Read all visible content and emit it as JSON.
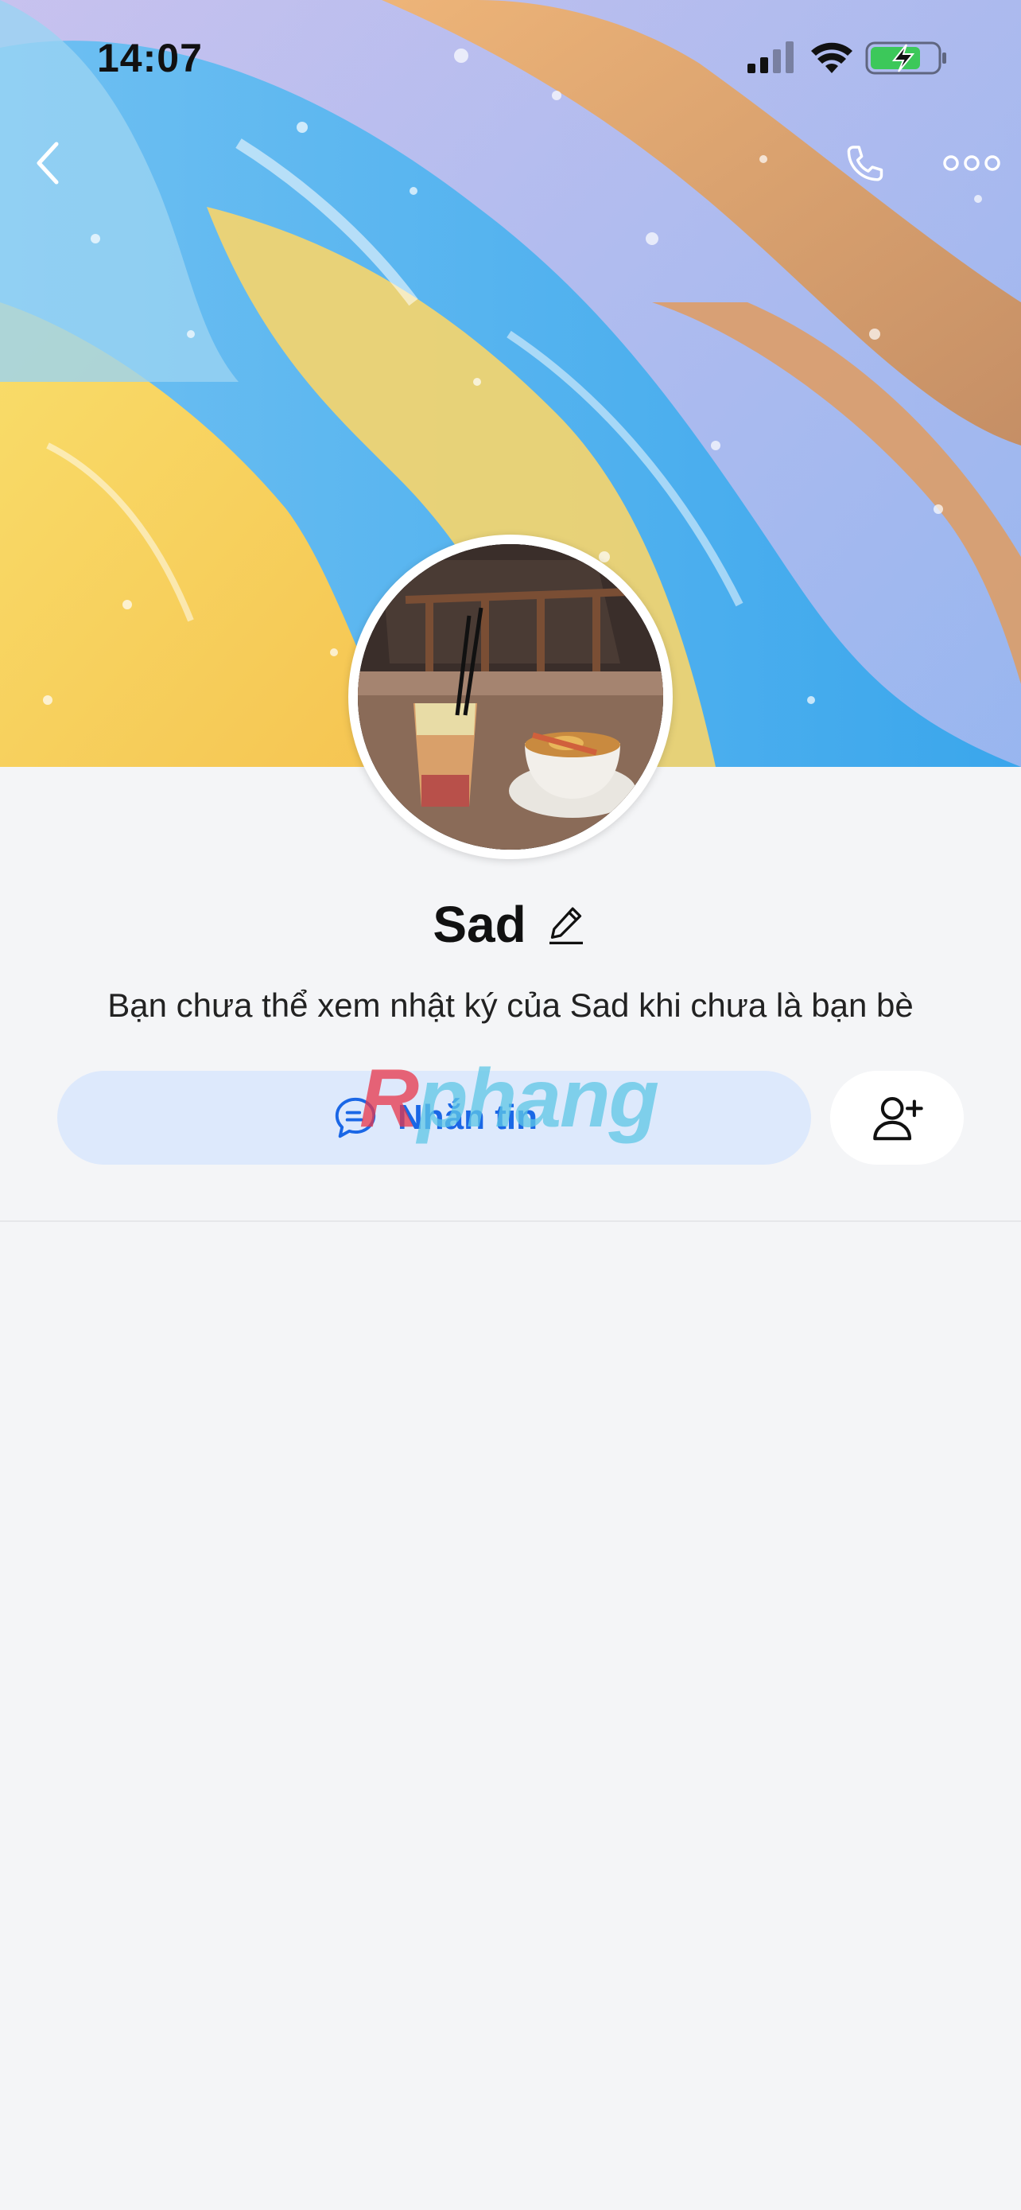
{
  "status_bar": {
    "time": "14:07",
    "icons": [
      "cellular-signal-icon",
      "wifi-icon",
      "battery-charging-icon"
    ]
  },
  "nav": {
    "icons": [
      "back-chevron-icon",
      "phone-icon",
      "more-dots-icon"
    ]
  },
  "profile": {
    "name": "Sad",
    "info_text": "Bạn chưa thể xem nhật ký của Sad khi chưa là bạn bè"
  },
  "actions": {
    "message_label": "Nhắn tin",
    "message_icon": "chat-bubble-icon",
    "add_friend_icon": "add-user-icon"
  },
  "watermark": {
    "part1": "R",
    "part2": "phang"
  },
  "colors": {
    "accent": "#1a67e6",
    "message_button_bg": "#dde9fc",
    "page_bg": "#f4f5f7"
  }
}
